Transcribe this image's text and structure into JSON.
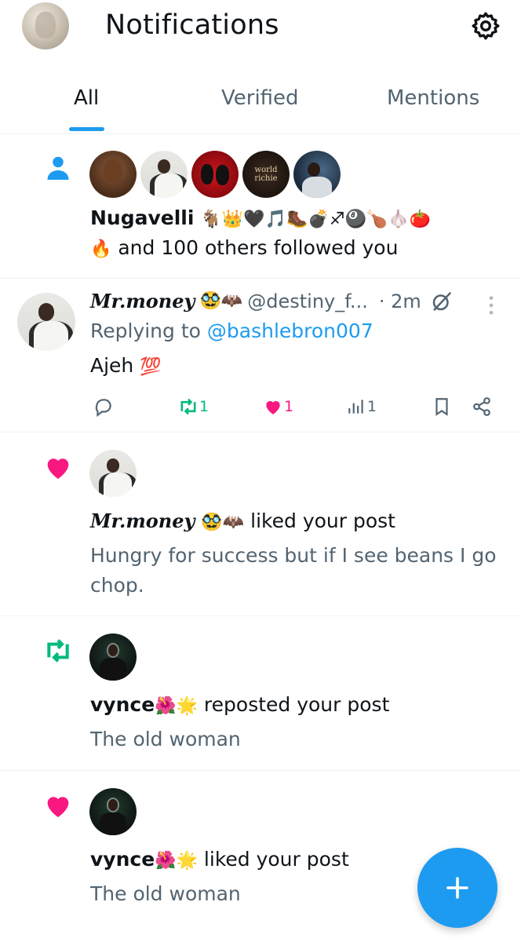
{
  "header": {
    "title": "Notifications",
    "avatar_icon": "profile-avatar",
    "settings_icon": "gear-icon"
  },
  "tabs": [
    {
      "label": "All",
      "active": true
    },
    {
      "label": "Verified",
      "active": false
    },
    {
      "label": "Mentions",
      "active": false
    }
  ],
  "follow_notification": {
    "icon": "person-icon",
    "name": "Nugavelli",
    "name_emojis": "🐐👑🖤🎵🥾💣♐🎱🍗🧄🍅",
    "text_emoji": "🔥",
    "text": "and 100 others followed you",
    "avatar_5_text": "world richie"
  },
  "reply_post": {
    "display_name": "Mr.money",
    "name_emojis": "🥸🦇",
    "handle": "@destiny_f...",
    "time": "· 2m",
    "replying_prefix": "Replying to",
    "replying_to": "@bashlebron007",
    "body": "Ajeh",
    "body_emoji": "💯",
    "reposts": "1",
    "likes": "1",
    "views": "1"
  },
  "like_notification_1": {
    "name": "Mr.money",
    "name_emojis": "🥸🦇",
    "action": "liked your post",
    "post_text": "Hungry for success but if I see beans I go chop."
  },
  "repost_notification": {
    "name": "vynce",
    "name_emojis": "🌺🌟",
    "action": "reposted your post",
    "post_text": "The old woman"
  },
  "like_notification_2": {
    "name": "vynce",
    "name_emojis": "🌺🌟",
    "action": "liked your post",
    "post_text": "The old woman"
  },
  "colors": {
    "accent": "#1d9bf0",
    "like": "#f91880",
    "repost": "#00ba7c",
    "secondary_text": "#536471"
  }
}
